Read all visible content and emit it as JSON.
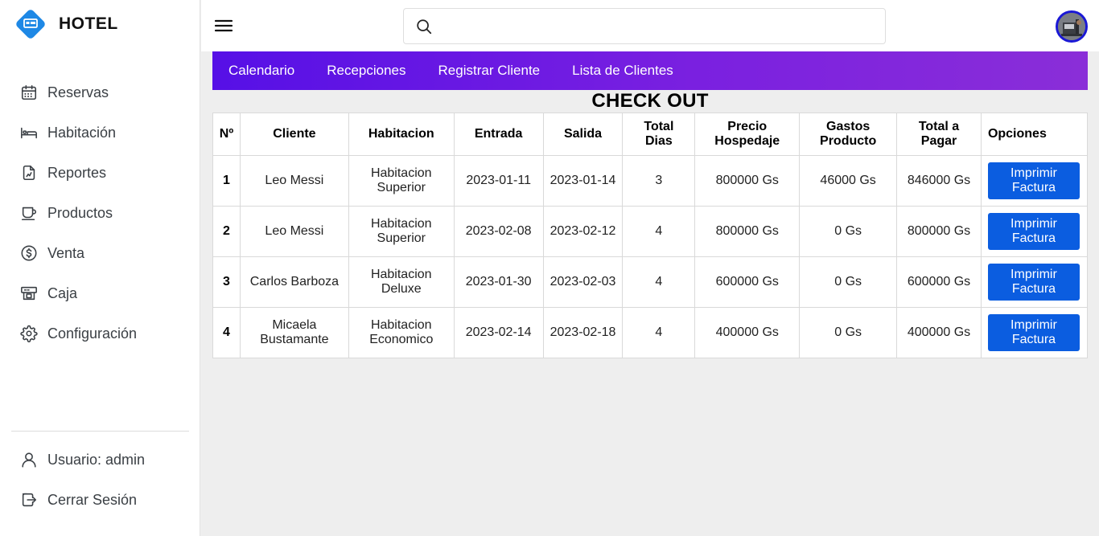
{
  "brand": {
    "title": "HOTEL"
  },
  "sidebar": {
    "items": [
      {
        "label": "Reservas",
        "icon": "calendar-icon"
      },
      {
        "label": "Habitación",
        "icon": "bed-icon"
      },
      {
        "label": "Reportes",
        "icon": "report-icon"
      },
      {
        "label": "Productos",
        "icon": "coffee-cup-icon"
      },
      {
        "label": "Venta",
        "icon": "dollar-icon"
      },
      {
        "label": "Caja",
        "icon": "cash-register-icon"
      },
      {
        "label": "Configuración",
        "icon": "gear-icon"
      }
    ],
    "bottom": [
      {
        "label": "Usuario: admin",
        "icon": "user-icon"
      },
      {
        "label": "Cerrar Sesión",
        "icon": "logout-icon"
      }
    ]
  },
  "search": {
    "placeholder": "",
    "value": ""
  },
  "tabs": [
    "Calendario",
    "Recepciones",
    "Registrar Cliente",
    "Lista de Clientes"
  ],
  "page": {
    "title": "CHECK OUT"
  },
  "table": {
    "headers": {
      "n": "Nº",
      "cliente": "Cliente",
      "habitacion": "Habitacion",
      "entrada": "Entrada",
      "salida": "Salida",
      "total_dias_1": "Total",
      "total_dias_2": "Dias",
      "precio_1": "Precio",
      "precio_2": "Hospedaje",
      "gastos_1": "Gastos",
      "gastos_2": "Producto",
      "total_1": "Total a",
      "total_2": "Pagar",
      "opciones": "Opciones"
    },
    "rows": [
      {
        "n": "1",
        "cliente_1": "Leo Messi",
        "cliente_2": "",
        "hab_1": "Habitacion",
        "hab_2": "Superior",
        "entrada": "2023-01-11",
        "salida": "2023-01-14",
        "dias": "3",
        "precio": "800000 Gs",
        "gastos": "46000 Gs",
        "total": "846000 Gs",
        "btn_1": "Imprimir",
        "btn_2": "Factura"
      },
      {
        "n": "2",
        "cliente_1": "Leo Messi",
        "cliente_2": "",
        "hab_1": "Habitacion",
        "hab_2": "Superior",
        "entrada": "2023-02-08",
        "salida": "2023-02-12",
        "dias": "4",
        "precio": "800000 Gs",
        "gastos": "0 Gs",
        "total": "800000 Gs",
        "btn_1": "Imprimir",
        "btn_2": "Factura"
      },
      {
        "n": "3",
        "cliente_1": "Carlos Barboza",
        "cliente_2": "",
        "hab_1": "Habitacion",
        "hab_2": "Deluxe",
        "entrada": "2023-01-30",
        "salida": "2023-02-03",
        "dias": "4",
        "precio": "600000 Gs",
        "gastos": "0 Gs",
        "total": "600000 Gs",
        "btn_1": "Imprimir",
        "btn_2": "Factura"
      },
      {
        "n": "4",
        "cliente_1": "Micaela",
        "cliente_2": "Bustamante",
        "hab_1": "Habitacion",
        "hab_2": "Economico",
        "entrada": "2023-02-14",
        "salida": "2023-02-18",
        "dias": "4",
        "precio": "400000 Gs",
        "gastos": "0 Gs",
        "total": "400000 Gs",
        "btn_1": "Imprimir",
        "btn_2": "Factura"
      }
    ]
  },
  "colors": {
    "accent_blue": "#0b5de0",
    "tabbar_start": "#5610e6",
    "tabbar_end": "#8a2ed8",
    "logo_blue": "#1e88e5"
  }
}
